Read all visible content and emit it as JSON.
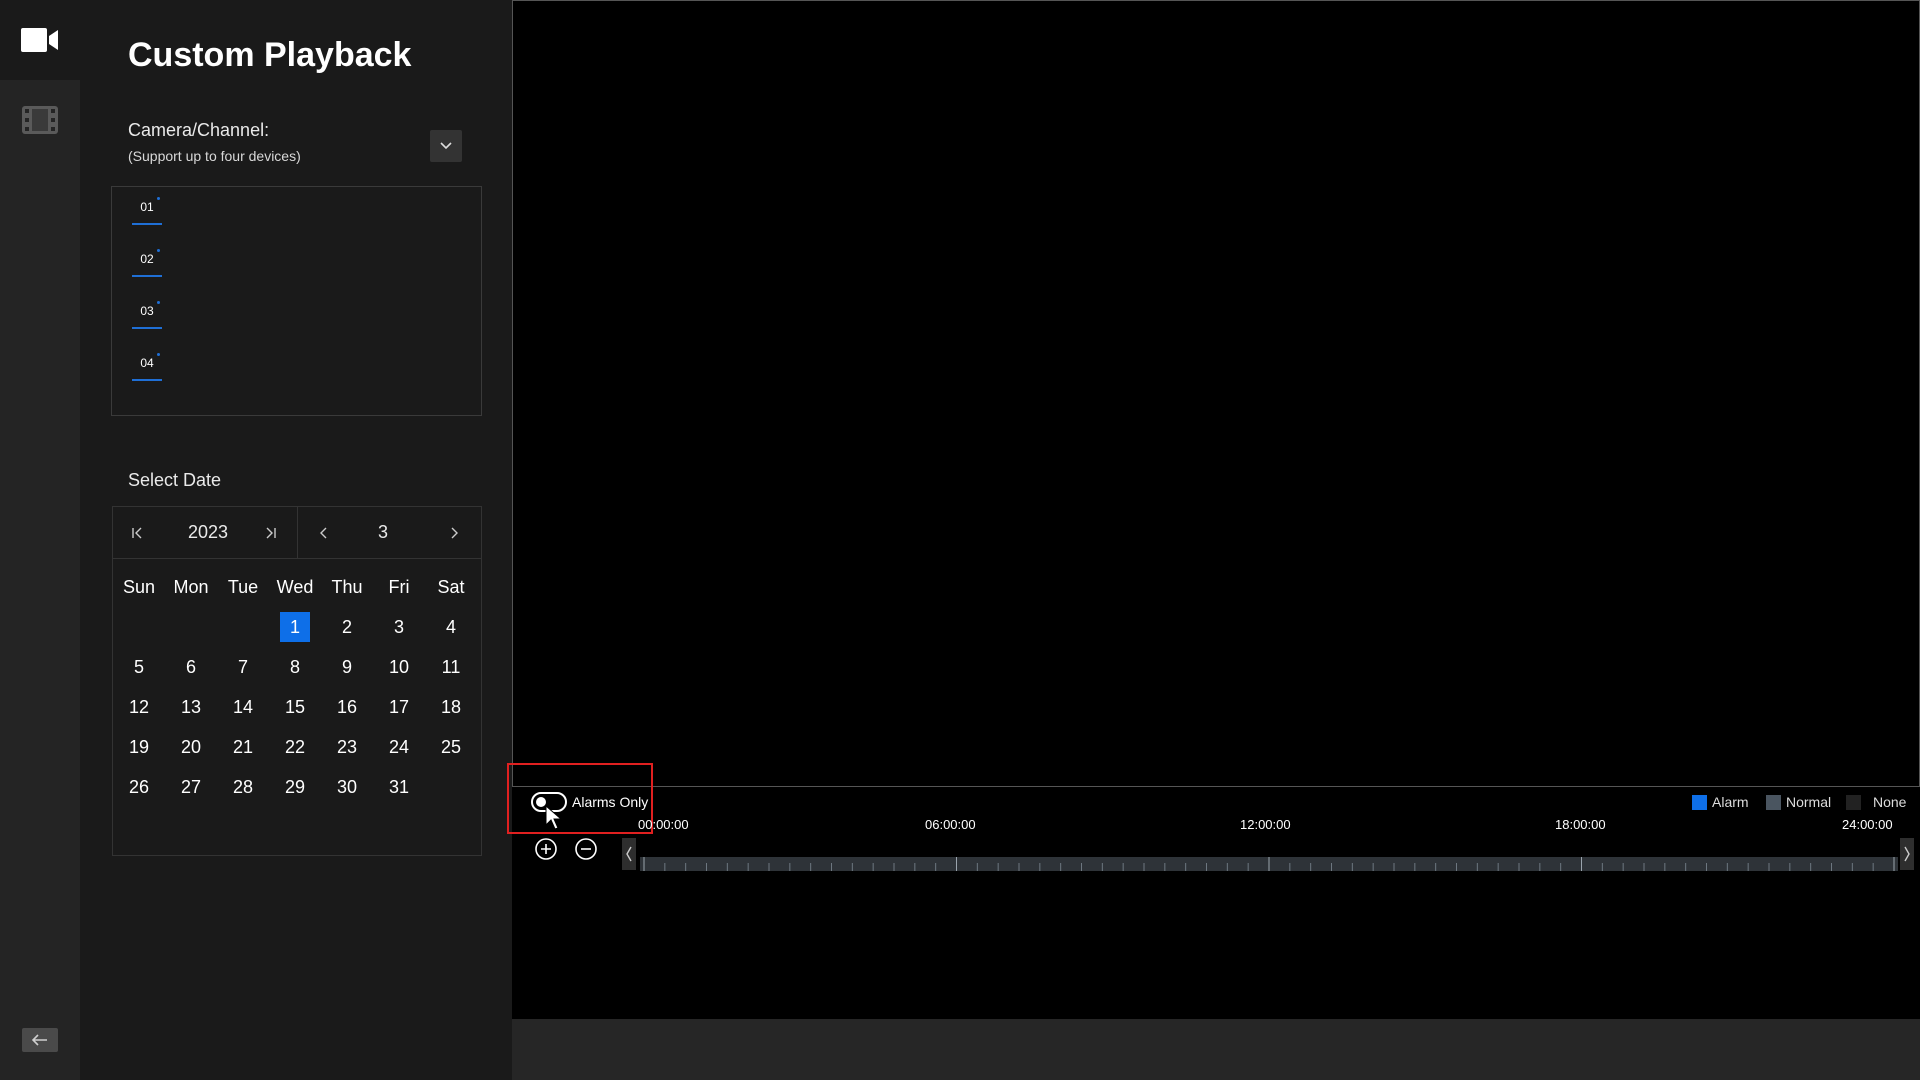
{
  "rail": {
    "items": [
      {
        "name": "camera-icon",
        "active": true
      },
      {
        "name": "film-icon",
        "active": false
      }
    ]
  },
  "panel": {
    "title": "Custom Playback",
    "camera_label": "Camera/Channel:",
    "camera_sub": "(Support up to four devices)",
    "channels": [
      "01",
      "02",
      "03",
      "04"
    ],
    "select_date": "Select Date"
  },
  "calendar": {
    "year": "2023",
    "month": "3",
    "weekdays": [
      "Sun",
      "Mon",
      "Tue",
      "Wed",
      "Thu",
      "Fri",
      "Sat"
    ],
    "weeks": [
      [
        "",
        "",
        "",
        "1",
        "2",
        "3",
        "4"
      ],
      [
        "5",
        "6",
        "7",
        "8",
        "9",
        "10",
        "11"
      ],
      [
        "12",
        "13",
        "14",
        "15",
        "16",
        "17",
        "18"
      ],
      [
        "19",
        "20",
        "21",
        "22",
        "23",
        "24",
        "25"
      ],
      [
        "26",
        "27",
        "28",
        "29",
        "30",
        "31",
        ""
      ]
    ],
    "selected_day": "1"
  },
  "timeline": {
    "alarms_only_label": "Alarms Only",
    "alarms_only_on": false,
    "timestamps": [
      "00:00:00",
      "06:00:00",
      "12:00:00",
      "18:00:00",
      "24:00:00"
    ],
    "legend": [
      {
        "label": "Alarm",
        "color": "#0e6fe8"
      },
      {
        "label": "Normal",
        "color": "#4a5560"
      },
      {
        "label": "None",
        "color": "#222222"
      }
    ]
  },
  "colors": {
    "accent": "#0e6fe8",
    "highlight": "#e02020"
  }
}
